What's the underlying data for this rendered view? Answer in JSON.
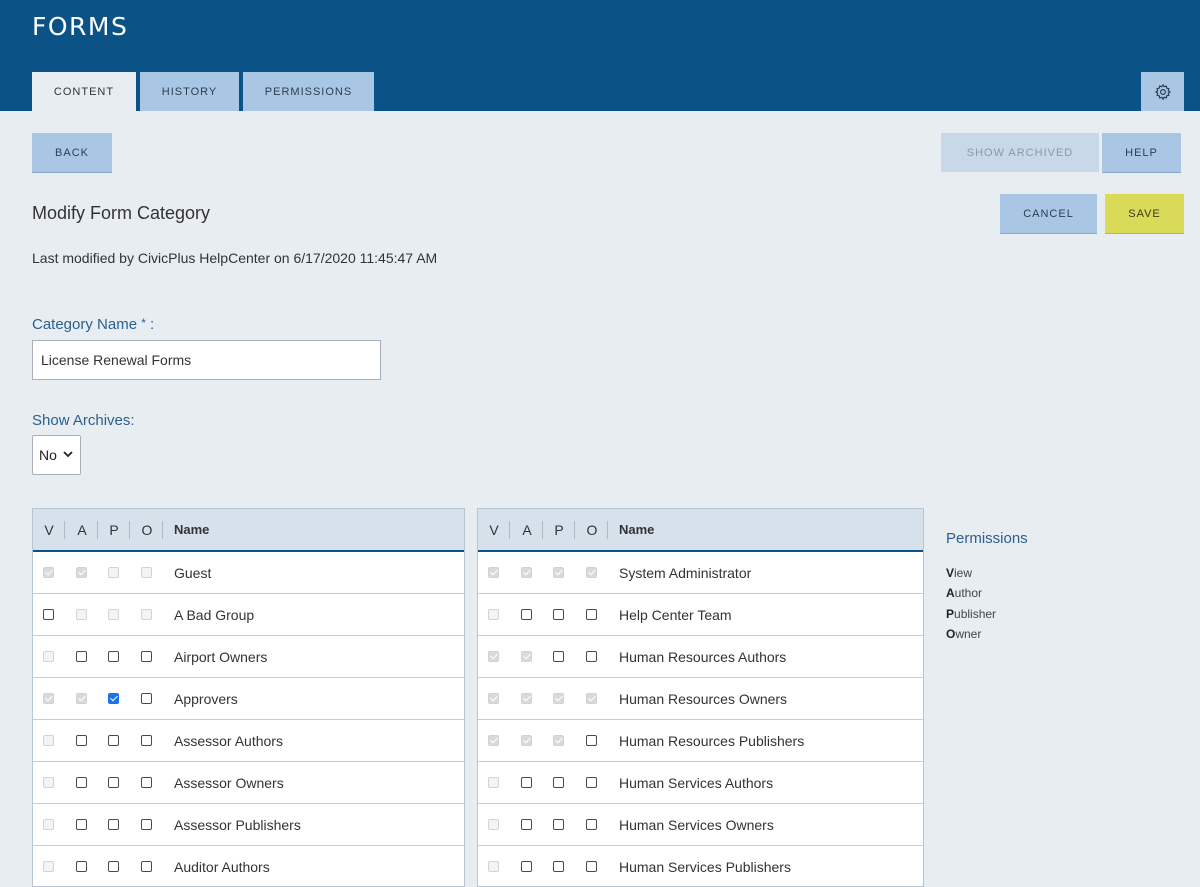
{
  "header": {
    "title": "FORMS",
    "tabs": [
      {
        "label": "CONTENT",
        "active": true
      },
      {
        "label": "HISTORY",
        "active": false
      },
      {
        "label": "PERMISSIONS",
        "active": false
      }
    ],
    "settings_icon": "gear-icon"
  },
  "toolbar": {
    "back_label": "BACK",
    "show_archived_label": "SHOW ARCHIVED",
    "help_label": "HELP",
    "cancel_label": "CANCEL",
    "save_label": "SAVE"
  },
  "form": {
    "heading": "Modify Form Category",
    "last_modified": "Last modified by CivicPlus HelpCenter on 6/17/2020 11:45:47 AM",
    "category_label": "Category Name",
    "required_mark": "*",
    "category_colon": " :",
    "category_value": "License Renewal Forms",
    "archives_label": "Show Archives:",
    "archives_value": "No"
  },
  "permissions": {
    "columns": [
      "V",
      "A",
      "P",
      "O",
      "Name"
    ],
    "left_rows": [
      {
        "name": "Guest",
        "v": [
          1,
          1,
          0,
          0
        ],
        "d": [
          1,
          1,
          1,
          1
        ]
      },
      {
        "name": "A Bad Group",
        "v": [
          0,
          0,
          0,
          0
        ],
        "d": [
          0,
          1,
          1,
          1
        ]
      },
      {
        "name": "Airport Owners",
        "v": [
          0,
          0,
          0,
          0
        ],
        "d": [
          1,
          0,
          0,
          0
        ]
      },
      {
        "name": "Approvers",
        "v": [
          1,
          1,
          1,
          0
        ],
        "d": [
          1,
          1,
          0,
          0
        ]
      },
      {
        "name": "Assessor Authors",
        "v": [
          0,
          0,
          0,
          0
        ],
        "d": [
          1,
          0,
          0,
          0
        ]
      },
      {
        "name": "Assessor Owners",
        "v": [
          0,
          0,
          0,
          0
        ],
        "d": [
          1,
          0,
          0,
          0
        ]
      },
      {
        "name": "Assessor Publishers",
        "v": [
          0,
          0,
          0,
          0
        ],
        "d": [
          1,
          0,
          0,
          0
        ]
      },
      {
        "name": "Auditor Authors",
        "v": [
          0,
          0,
          0,
          0
        ],
        "d": [
          1,
          0,
          0,
          0
        ]
      }
    ],
    "right_rows": [
      {
        "name": "System Administrator",
        "v": [
          1,
          1,
          1,
          1
        ],
        "d": [
          1,
          1,
          1,
          1
        ]
      },
      {
        "name": "Help Center Team",
        "v": [
          0,
          0,
          0,
          0
        ],
        "d": [
          1,
          0,
          0,
          0
        ]
      },
      {
        "name": "Human Resources Authors",
        "v": [
          1,
          1,
          0,
          0
        ],
        "d": [
          1,
          1,
          0,
          0
        ]
      },
      {
        "name": "Human Resources Owners",
        "v": [
          1,
          1,
          1,
          1
        ],
        "d": [
          1,
          1,
          1,
          1
        ]
      },
      {
        "name": "Human Resources Publishers",
        "v": [
          1,
          1,
          1,
          0
        ],
        "d": [
          1,
          1,
          1,
          0
        ]
      },
      {
        "name": "Human Services Authors",
        "v": [
          0,
          0,
          0,
          0
        ],
        "d": [
          1,
          0,
          0,
          0
        ]
      },
      {
        "name": "Human Services Owners",
        "v": [
          0,
          0,
          0,
          0
        ],
        "d": [
          1,
          0,
          0,
          0
        ]
      },
      {
        "name": "Human Services Publishers",
        "v": [
          0,
          0,
          0,
          0
        ],
        "d": [
          1,
          0,
          0,
          0
        ]
      }
    ],
    "legend": {
      "title": "Permissions",
      "items": [
        {
          "key": "V",
          "rest": "iew"
        },
        {
          "key": "A",
          "rest": "uthor"
        },
        {
          "key": "P",
          "rest": "ublisher"
        },
        {
          "key": "O",
          "rest": "wner"
        }
      ]
    }
  }
}
